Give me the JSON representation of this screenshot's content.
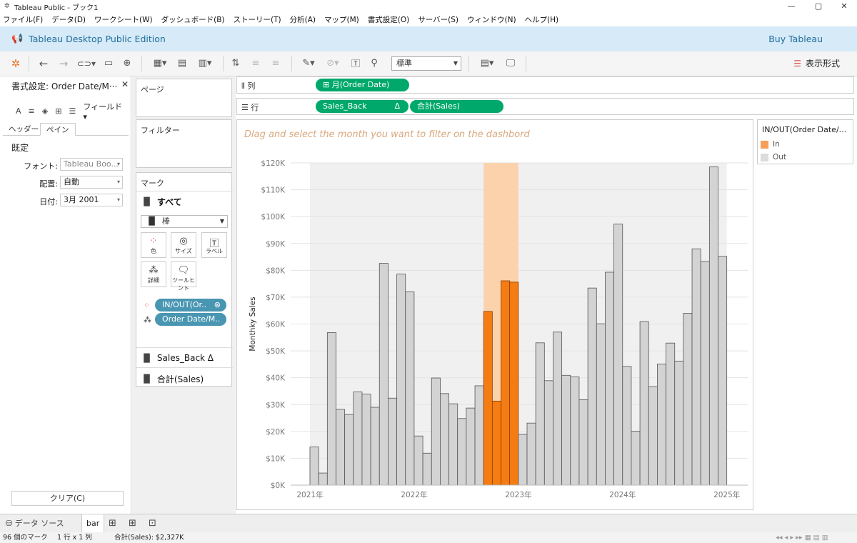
{
  "window": {
    "title": "Tableau Public - ブック1",
    "min": "—",
    "max": "▢",
    "close": "✕"
  },
  "menu": [
    "ファイル(F)",
    "データ(D)",
    "ワークシート(W)",
    "ダッシュボード(B)",
    "ストーリー(T)",
    "分析(A)",
    "マップ(M)",
    "書式設定(O)",
    "サーバー(S)",
    "ウィンドウ(N)",
    "ヘルプ(H)"
  ],
  "banner": {
    "edition": "Tableau Desktop Public Edition",
    "buy": "Buy Tableau"
  },
  "toolbar": {
    "fit": "標準",
    "show_me": "表示形式"
  },
  "format_pane": {
    "title": "書式設定: Order Date/M···",
    "close": "✕",
    "field_label": "フィールド▾",
    "icon_a": "A",
    "tabs": [
      "ヘッダー",
      "ペイン"
    ],
    "section": "既定",
    "font_label": "フォント:",
    "font_value": "Tableau Boo...",
    "align_label": "配置:",
    "align_value": "自動",
    "date_label": "日付:",
    "date_value": "3月 2001",
    "clear": "クリア(C)"
  },
  "shelves": {
    "pages": "ページ",
    "filters": "フィルター",
    "marks": "マーク",
    "marks_all": "すべて",
    "mark_type": "棒",
    "buttons": {
      "color": "色",
      "size": "サイズ",
      "label": "ラベル",
      "detail": "詳細",
      "tooltip": "ツールヒント"
    },
    "pill_inout": "IN/OUT(Or..",
    "pill_orderdate": "Order Date/M..",
    "sales_back": "Sales_Back Δ",
    "sum_sales": "合計(Sales)",
    "columns_label": "列",
    "rows_label": "行",
    "columns_pill": "⊞ 月(Order Date)",
    "rows_pill1": "Sales_Back",
    "rows_pill1_delta": "Δ",
    "rows_pill2": "合計(Sales)"
  },
  "legend": {
    "title": "IN/OUT(Order Date/...",
    "items": [
      {
        "label": "In",
        "color": "#f79f5a"
      },
      {
        "label": "Out",
        "color": "#dcdcdc"
      }
    ]
  },
  "bottom": {
    "datasource": "データ ソース",
    "sheet": "bar"
  },
  "status": {
    "marks": "96 個のマーク",
    "rowcol": "1 行 x 1 列",
    "sum": "合計(Sales): $2,327K"
  },
  "chart_data": {
    "type": "bar",
    "title": "Dlag and select the month you want to filter on the dashbord",
    "ylabel": "Monthky Sales",
    "ylim": [
      0,
      120000
    ],
    "yticks": [
      "$0K",
      "$10K",
      "$20K",
      "$30K",
      "$40K",
      "$50K",
      "$60K",
      "$70K",
      "$80K",
      "$90K",
      "$100K",
      "$110K",
      "$120K"
    ],
    "xticks": [
      "2021年",
      "2022年",
      "2023年",
      "2024年",
      "2025年"
    ],
    "colors": {
      "in": "#f57c12",
      "out": "#d3d3d3",
      "band": "#fcd2ad",
      "background_band": "#f0f0f0"
    },
    "categories": [
      "2021-01",
      "2021-02",
      "2021-03",
      "2021-04",
      "2021-05",
      "2021-06",
      "2021-07",
      "2021-08",
      "2021-09",
      "2021-10",
      "2021-11",
      "2021-12",
      "2022-01",
      "2022-02",
      "2022-03",
      "2022-04",
      "2022-05",
      "2022-06",
      "2022-07",
      "2022-08",
      "2022-09",
      "2022-10",
      "2022-11",
      "2022-12",
      "2023-01",
      "2023-02",
      "2023-03",
      "2023-04",
      "2023-05",
      "2023-06",
      "2023-07",
      "2023-08",
      "2023-09",
      "2023-10",
      "2023-11",
      "2023-12",
      "2024-01",
      "2024-02",
      "2024-03",
      "2024-04",
      "2024-05",
      "2024-06",
      "2024-07",
      "2024-08",
      "2024-09",
      "2024-10",
      "2024-11",
      "2024-12"
    ],
    "values": [
      14200,
      4500,
      56800,
      28200,
      26300,
      34700,
      33900,
      29000,
      82600,
      32400,
      78600,
      72000,
      18300,
      11900,
      39900,
      34100,
      30300,
      24800,
      28700,
      37000,
      64700,
      31300,
      76100,
      75600,
      18900,
      23100,
      53000,
      38900,
      57000,
      40900,
      40300,
      31800,
      73400,
      60100,
      79300,
      97200,
      44200,
      20100,
      60900,
      36700,
      45100,
      52900,
      46200,
      64000,
      88000,
      83300,
      118500,
      85200
    ],
    "in_range": [
      "2022-09",
      "2022-12"
    ]
  }
}
